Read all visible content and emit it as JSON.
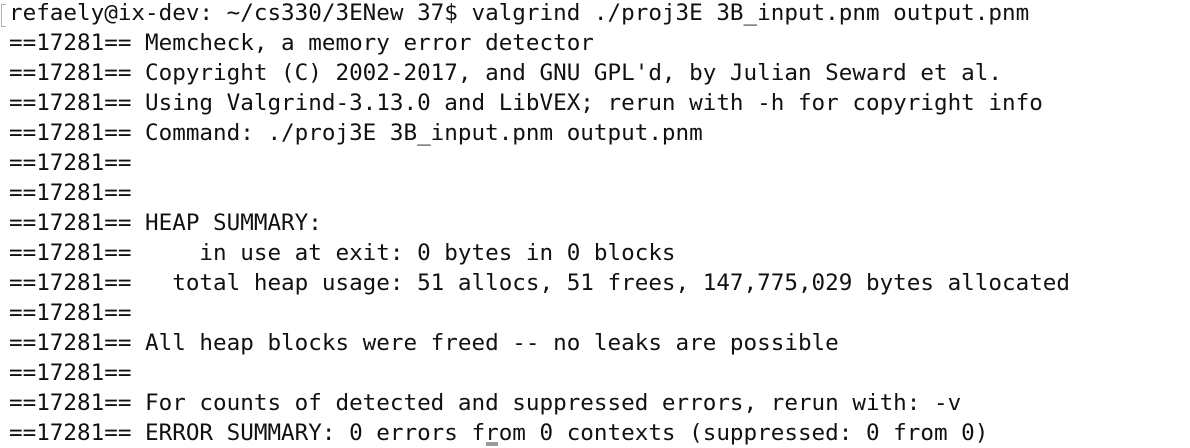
{
  "terminal": {
    "lines": [
      "refaely@ix-dev: ~/cs330/3ENew 37$ valgrind ./proj3E 3B_input.pnm output.pnm",
      "==17281== Memcheck, a memory error detector",
      "==17281== Copyright (C) 2002-2017, and GNU GPL'd, by Julian Seward et al.",
      "==17281== Using Valgrind-3.13.0 and LibVEX; rerun with -h for copyright info",
      "==17281== Command: ./proj3E 3B_input.pnm output.pnm",
      "==17281==",
      "==17281==",
      "==17281== HEAP SUMMARY:",
      "==17281==     in use at exit: 0 bytes in 0 blocks",
      "==17281==   total heap usage: 51 allocs, 51 frees, 147,775,029 bytes allocated",
      "==17281==",
      "==17281== All heap blocks were freed -- no leaks are possible",
      "==17281==",
      "==17281== For counts of detected and suppressed errors, rerun with: -v",
      "==17281== ERROR SUMMARY: 0 errors from 0 contexts (suppressed: 0 from 0)"
    ]
  }
}
